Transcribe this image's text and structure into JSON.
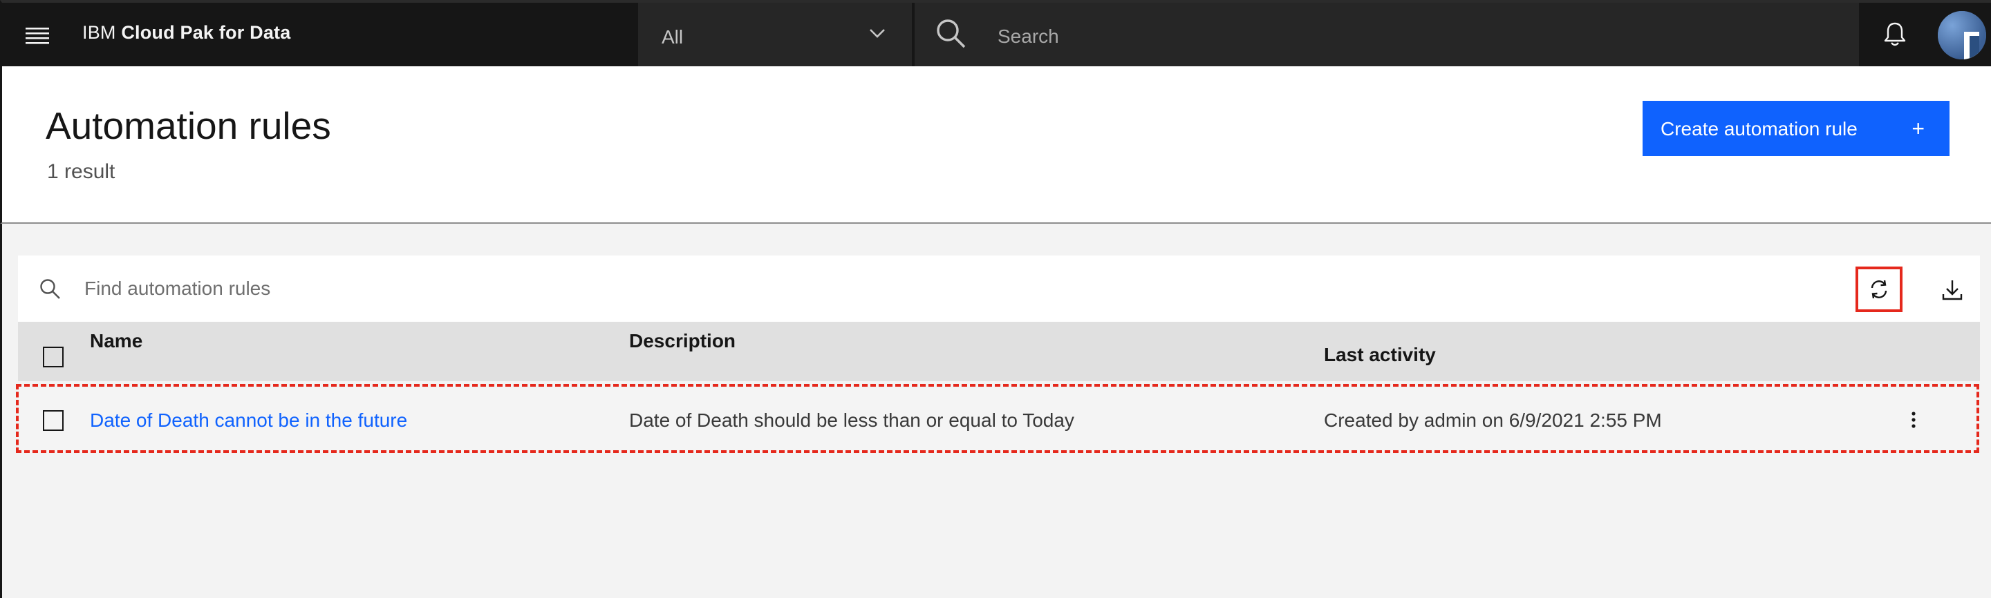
{
  "topbar": {
    "brand_prefix": "IBM ",
    "brand_name": "Cloud Pak for Data",
    "scope_value": "All",
    "search_placeholder": "Search",
    "icons": [
      "menu-icon",
      "chevron-down-icon",
      "search-icon",
      "bell-icon",
      "avatar"
    ]
  },
  "header": {
    "title": "Automation rules",
    "result_count": "1 result",
    "create_button_label": "Create automation rule",
    "create_button_icon": "+"
  },
  "toolbar": {
    "search_placeholder": "Find automation rules",
    "icons": [
      "search-icon",
      "refresh-icon",
      "download-icon"
    ]
  },
  "table": {
    "columns": [
      "Name",
      "Description",
      "Last activity"
    ],
    "rows": [
      {
        "name": "Date of Death cannot be in the future",
        "description": "Date of Death should be less than or equal to Today",
        "last_activity": "Created by admin on 6/9/2021 2:55 PM"
      }
    ]
  },
  "colors": {
    "topbar_bg": "#161616",
    "primary": "#0f62fe",
    "highlight": "#e5281c",
    "table_header_bg": "#e0e0e0"
  }
}
